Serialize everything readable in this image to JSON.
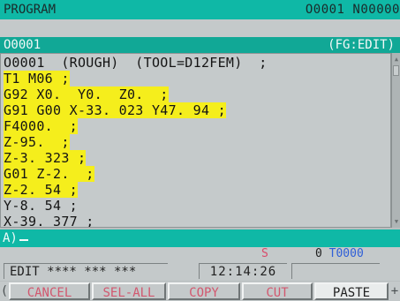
{
  "header": {
    "title": "PROGRAM",
    "program_number": "O0001 N00000"
  },
  "program_bar": {
    "name": "O0001",
    "mode": "(FG:EDIT)"
  },
  "editor": {
    "lines": [
      {
        "text": "O0001  (ROUGH)  (TOOL=D12FEM)  ;",
        "highlighted": false
      },
      {
        "text": "T1 M06 ;",
        "highlighted": true
      },
      {
        "text": "G92 X0.  Y0.  Z0.  ;",
        "highlighted": true
      },
      {
        "text": "G91 G00 X-33. 023 Y47. 94 ;",
        "highlighted": true
      },
      {
        "text": "F4000.  ;",
        "highlighted": true
      },
      {
        "text": "Z-95.  ;",
        "highlighted": true
      },
      {
        "text": "Z-3. 323 ;",
        "highlighted": true
      },
      {
        "text": "G01 Z-2.  ;",
        "highlighted": true
      },
      {
        "text": "Z-2. 54 ;",
        "highlighted": true
      },
      {
        "text": "Y-8. 54 ;",
        "highlighted": false
      },
      {
        "text": "X-39. 377 ;",
        "highlighted": false
      }
    ],
    "highlight_color": "#f5ee1c"
  },
  "input": {
    "prompt": "A)"
  },
  "status": {
    "s_label": "S",
    "t_prefix": "0",
    "t_value": "T0000",
    "mode_text": "EDIT **** ***  ***",
    "time": "12:14:26"
  },
  "softkeys": {
    "left_edge": "(",
    "right_edge": "+",
    "keys": [
      {
        "label": "CANCEL"
      },
      {
        "label": "SEL-ALL"
      },
      {
        "label": "COPY"
      },
      {
        "label": "CUT"
      },
      {
        "label": "PASTE"
      }
    ]
  },
  "colors": {
    "accent": "#0fb8a6",
    "softkey_text": "#d2576e"
  }
}
